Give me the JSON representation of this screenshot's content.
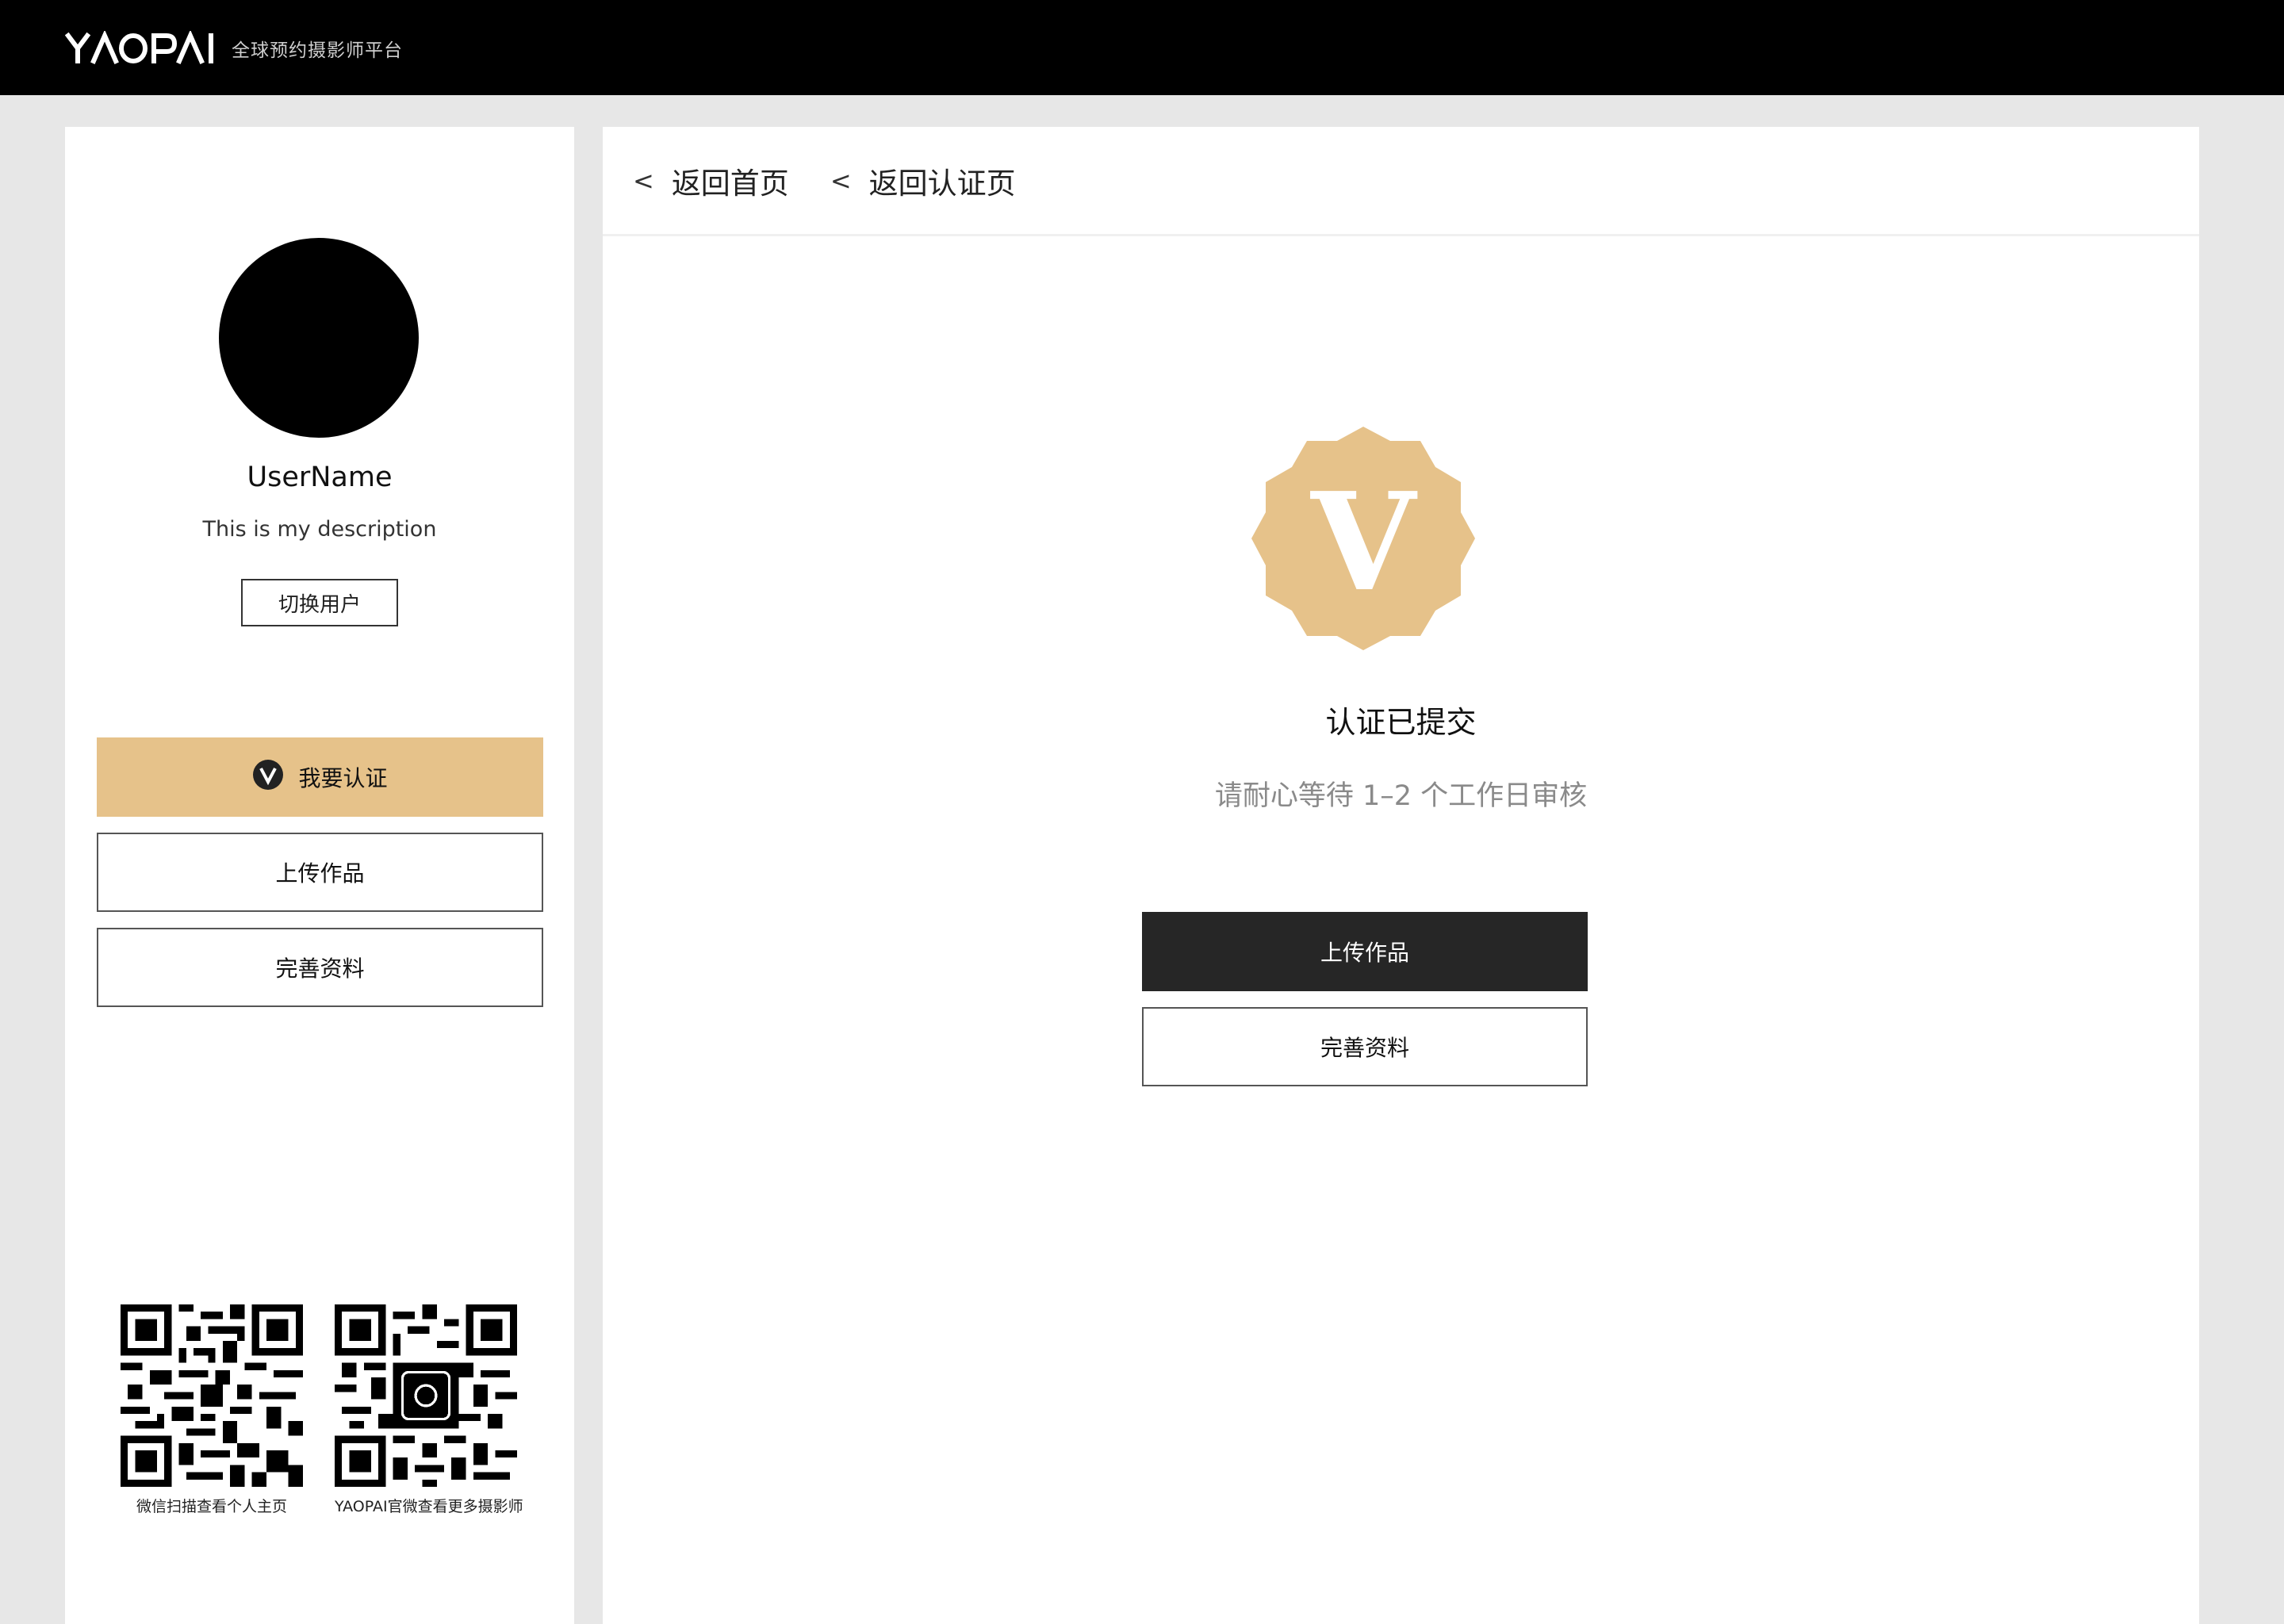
{
  "header": {
    "logo_text": "YAOPAI",
    "tagline": "全球预约摄影师平台"
  },
  "profile": {
    "username": "UserName",
    "description": "This is my description",
    "switch_user_label": "切换用户"
  },
  "sidebar": {
    "certify_label": "我要认证",
    "upload_label": "上传作品",
    "complete_label": "完善资料",
    "accent_color": "#e6c28a"
  },
  "qr_codes": [
    {
      "caption": "微信扫描查看个人主页"
    },
    {
      "caption": "YAOPAI官微查看更多摄影师"
    }
  ],
  "breadcrumbs": [
    {
      "label": "返回首页"
    },
    {
      "label": "返回认证页"
    }
  ],
  "status": {
    "title": "认证已提交",
    "subtitle": "请耐心等待 1–2 个工作日审核",
    "badge_letter": "V"
  },
  "actions": {
    "upload_label": "上传作品",
    "complete_label": "完善资料"
  }
}
